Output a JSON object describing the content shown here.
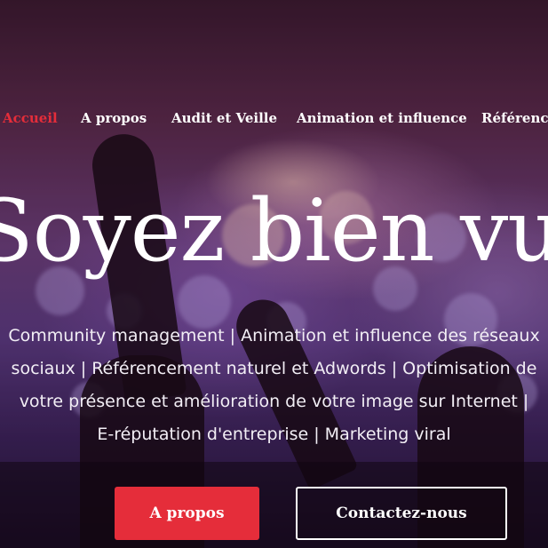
{
  "nav": {
    "items": [
      {
        "label": "Accueil",
        "active": true
      },
      {
        "label": "A propos",
        "active": false
      },
      {
        "label": "Audit et Veille",
        "active": false
      },
      {
        "label": "Animation et influence",
        "active": false
      },
      {
        "label": "Référence",
        "active": false
      }
    ]
  },
  "hero": {
    "title": "Soyez bien vu",
    "subtitle_lines": [
      "Community management | Animation et influence des réseaux",
      "sociaux | Référencement naturel et Adwords | Optimisation de",
      "votre présence et amélioration de votre image sur Internet |",
      "E-réputation d'entreprise | Marketing viral"
    ]
  },
  "buttons": {
    "primary_label": "A propos",
    "secondary_label": "Contactez-nous"
  },
  "colors": {
    "accent": "#e52d3a",
    "text": "#ffffff"
  }
}
